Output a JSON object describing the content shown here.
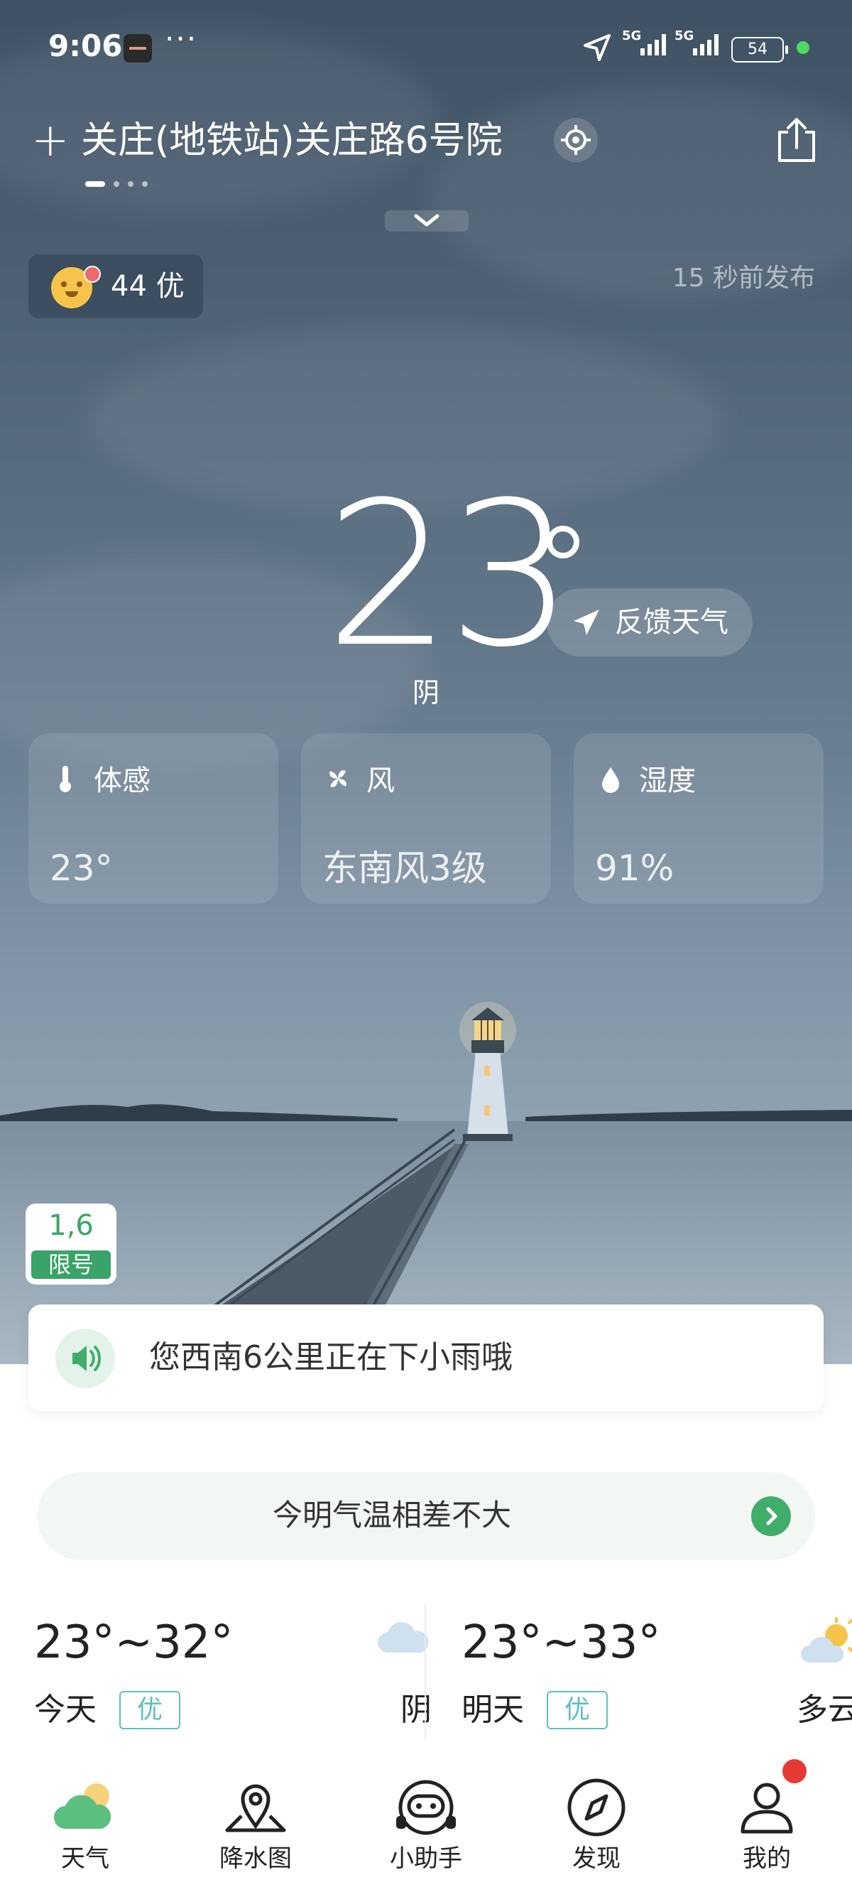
{
  "status_bar": {
    "time": "9:06",
    "more": "···",
    "signal1": "5G",
    "signal2": "5G",
    "battery": "54"
  },
  "header": {
    "add_icon": "plus-icon",
    "location": "关庄(地铁站)关庄路6号院",
    "locate_icon": "locate-icon",
    "share_icon": "share-icon"
  },
  "aqi": {
    "value": "44",
    "level": "优"
  },
  "publish_time": "15 秒前发布",
  "current": {
    "temperature": "23",
    "condition": "阴",
    "feedback_label": "反馈天气"
  },
  "cards": [
    {
      "label": "体感",
      "value": "23°",
      "icon": "thermometer-icon"
    },
    {
      "label": "风",
      "value": "东南风3级",
      "icon": "fan-icon"
    },
    {
      "label": "湿度",
      "value": "91%",
      "icon": "droplet-icon"
    }
  ],
  "traffic_limit": {
    "numbers": "1,6",
    "label": "限号"
  },
  "alert": {
    "text": "您西南6公里正在下小雨哦",
    "icon": "speaker-icon"
  },
  "tip": {
    "text": "今明气温相差不大"
  },
  "forecast": [
    {
      "range": "23°~32°",
      "day": "今天",
      "quality": "优",
      "weather": "阴",
      "icon": "cloud-icon"
    },
    {
      "range": "23°~33°",
      "day": "明天",
      "quality": "优",
      "weather": "多云",
      "icon": "partly-cloudy-icon"
    }
  ],
  "nav": [
    {
      "label": "天气",
      "icon": "weather-icon"
    },
    {
      "label": "降水图",
      "icon": "map-pin-icon"
    },
    {
      "label": "小助手",
      "icon": "assistant-icon"
    },
    {
      "label": "发现",
      "icon": "compass-icon"
    },
    {
      "label": "我的",
      "icon": "profile-icon"
    }
  ],
  "colors": {
    "accent_green": "#3fae6a",
    "quality_teal": "#5fc0c0",
    "notification_red": "#e53935"
  }
}
